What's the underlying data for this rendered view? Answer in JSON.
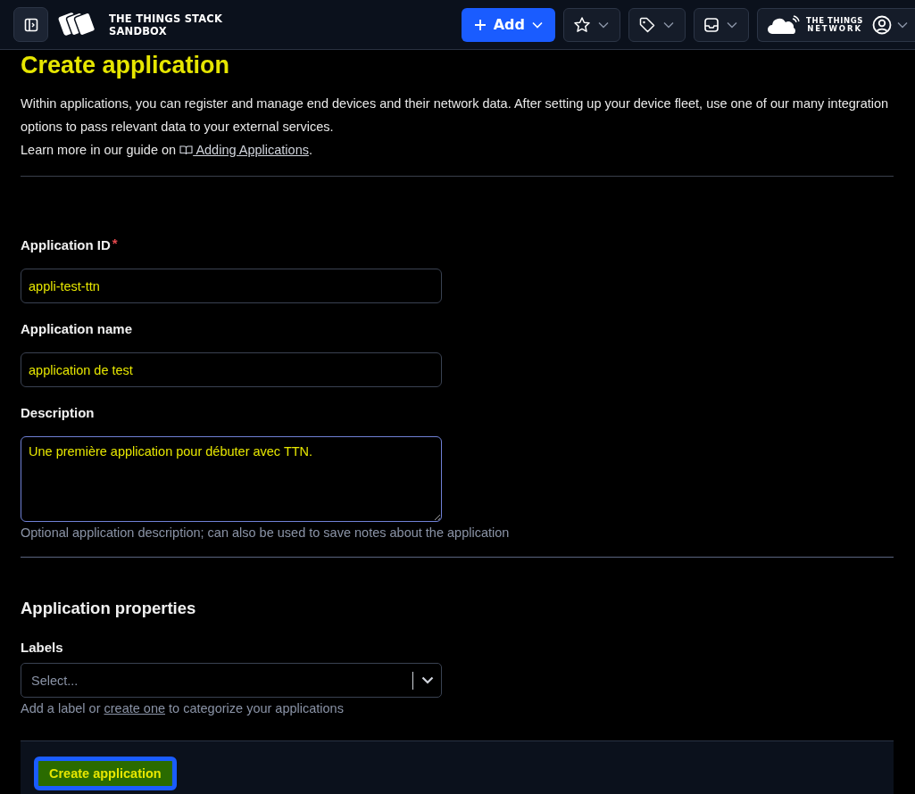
{
  "topbar": {
    "product_line1": "THE THINGS STACK",
    "product_line2": "SANDBOX",
    "add_button": "Add",
    "network_line1": "THE THINGS",
    "network_line2": "NETWORK"
  },
  "page": {
    "title": "Create application",
    "intro": "Within applications, you can register and manage end devices and their network data. After setting up your device fleet, use one of our many integration options to pass relevant data to your external services.",
    "guide_prefix": "Learn more in our guide on",
    "guide_link": "Adding Applications",
    "guide_suffix": "."
  },
  "fields": [
    {
      "kind": "input",
      "label": "Application ID",
      "required_mark": "*",
      "focused": false,
      "value": "appli-test-ttn"
    },
    {
      "kind": "input",
      "label": "Application name",
      "focused": false,
      "value": "application de test"
    },
    {
      "kind": "textarea",
      "label": "Description",
      "focused": true,
      "value": "Une première application pour débuter avec TTN.",
      "hint": "Optional application description; can also be used to save notes about the application"
    }
  ],
  "properties": {
    "title": "Application properties",
    "label": "Labels",
    "placeholder": "Select...",
    "hint_prefix": "Add a label or",
    "hint_link": "create one",
    "hint_suffix": "to categorize your applications"
  },
  "submit": "Create application"
}
